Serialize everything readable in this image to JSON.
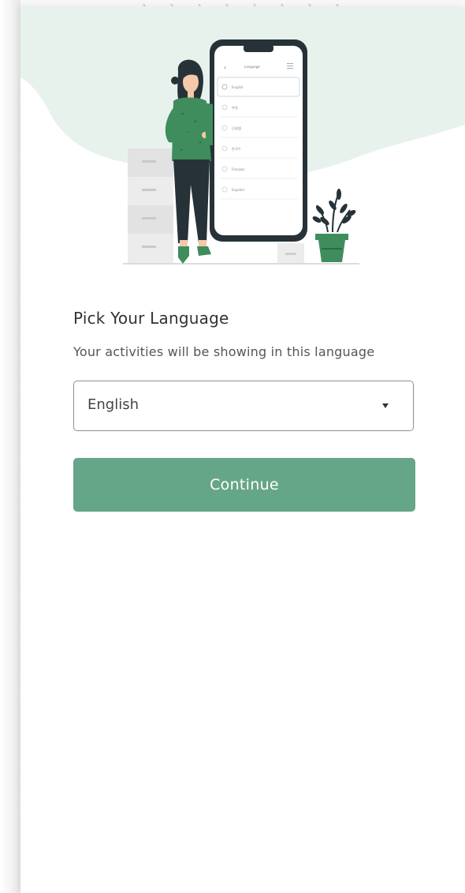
{
  "colors": {
    "accent": "#66a688",
    "illustration_green": "#3f8d5c",
    "blob": "#e8f2ed",
    "dark": "#263238"
  },
  "illustration": {
    "name": "person-with-phone-illustration",
    "phone_header": "Language",
    "phone_options": [
      "English",
      "中文",
      "日本語",
      "한국어",
      "Français",
      "Español"
    ]
  },
  "language_screen": {
    "title": "Pick Your Language",
    "subtitle": "Your activities will be showing in this language",
    "language_select": {
      "selected_value": "English",
      "icon": "caret-down-icon"
    },
    "continue_label": "Continue"
  }
}
